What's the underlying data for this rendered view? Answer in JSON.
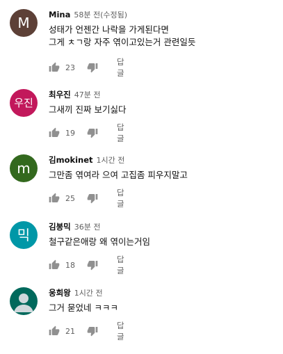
{
  "reply_label": "답글",
  "comments": [
    {
      "author": "Mina",
      "time": "58분 전(수정됨)",
      "avatar": {
        "letter": "M",
        "color": "#5d4037"
      },
      "lines": [
        "성태가 언젠간 나락을 가게된다면",
        "그게 ㅊㄱ랑 자주 엮이고있는거 관련일듯"
      ],
      "likes": "23"
    },
    {
      "author": "최우진",
      "time": "47분 전",
      "avatar": {
        "letter": "우진",
        "color": "#c2185b"
      },
      "lines": [
        "그새끼 진짜 보기싫다"
      ],
      "likes": "19"
    },
    {
      "author": "김mokinet",
      "time": "1시간 전",
      "avatar": {
        "letter": "m",
        "color": "#33691e"
      },
      "lines": [
        "그만좀 엮여라 으여  고집좀 피우지말고"
      ],
      "likes": "25"
    },
    {
      "author": "김봉믹",
      "time": "36분 전",
      "avatar": {
        "letter": "믹",
        "color": "#0097a7"
      },
      "lines": [
        "철구같은애랑 왜 엮이는거임"
      ],
      "likes": "18"
    },
    {
      "author": "웅희왕",
      "time": "1시간 전",
      "avatar": {
        "letter": "",
        "color": "#00695c"
      },
      "lines": [
        "그거 묻었네 ㅋㅋㅋ"
      ],
      "likes": "21"
    }
  ]
}
